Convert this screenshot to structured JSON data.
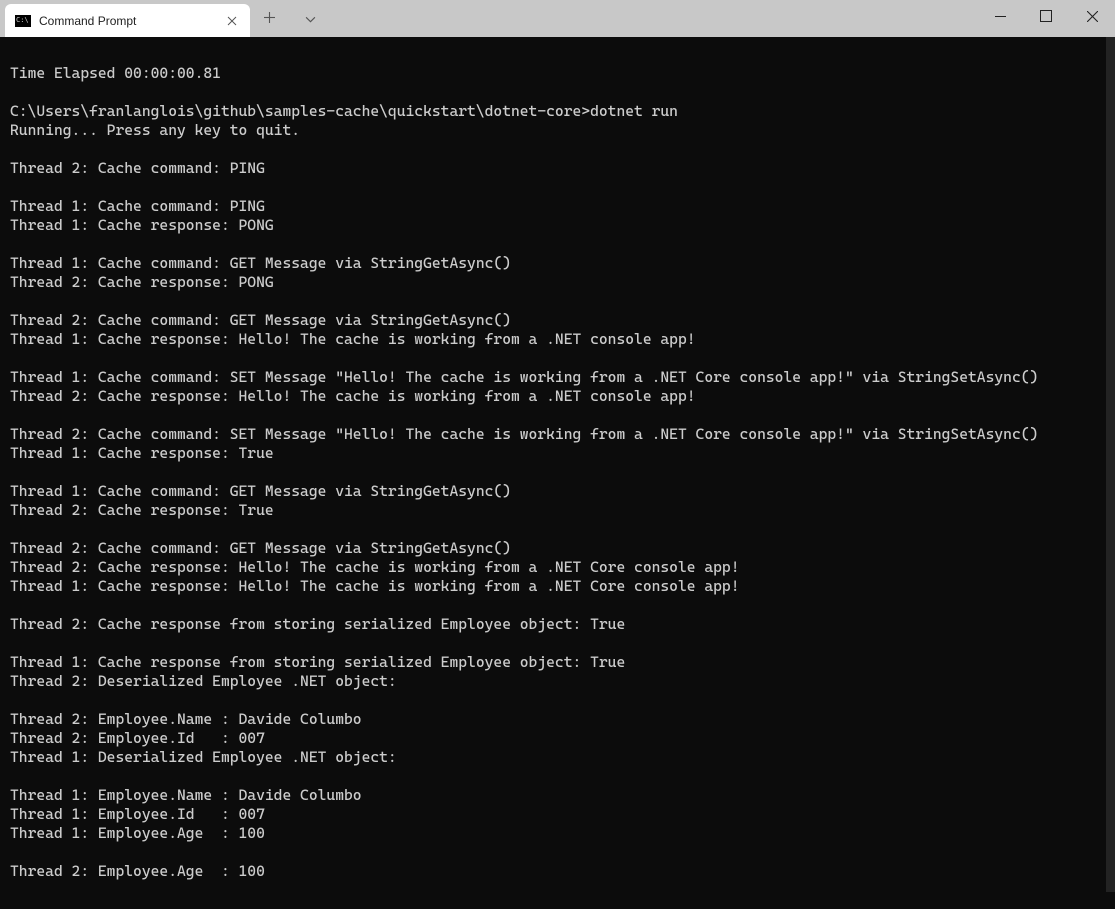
{
  "tab": {
    "title": "Command Prompt"
  },
  "terminal": {
    "lines": [
      "",
      "Time Elapsed 00:00:00.81",
      "",
      "C:\\Users\\franlanglois\\github\\samples-cache\\quickstart\\dotnet-core>dotnet run",
      "Running... Press any key to quit.",
      "",
      "Thread 2: Cache command: PING",
      "",
      "Thread 1: Cache command: PING",
      "Thread 1: Cache response: PONG",
      "",
      "Thread 1: Cache command: GET Message via StringGetAsync()",
      "Thread 2: Cache response: PONG",
      "",
      "Thread 2: Cache command: GET Message via StringGetAsync()",
      "Thread 1: Cache response: Hello! The cache is working from a .NET console app!",
      "",
      "Thread 1: Cache command: SET Message \"Hello! The cache is working from a .NET Core console app!\" via StringSetAsync()",
      "Thread 2: Cache response: Hello! The cache is working from a .NET console app!",
      "",
      "Thread 2: Cache command: SET Message \"Hello! The cache is working from a .NET Core console app!\" via StringSetAsync()",
      "Thread 1: Cache response: True",
      "",
      "Thread 1: Cache command: GET Message via StringGetAsync()",
      "Thread 2: Cache response: True",
      "",
      "Thread 2: Cache command: GET Message via StringGetAsync()",
      "Thread 2: Cache response: Hello! The cache is working from a .NET Core console app!",
      "Thread 1: Cache response: Hello! The cache is working from a .NET Core console app!",
      "",
      "Thread 2: Cache response from storing serialized Employee object: True",
      "",
      "Thread 1: Cache response from storing serialized Employee object: True",
      "Thread 2: Deserialized Employee .NET object:",
      "",
      "Thread 2: Employee.Name : Davide Columbo",
      "Thread 2: Employee.Id   : 007",
      "Thread 1: Deserialized Employee .NET object:",
      "",
      "Thread 1: Employee.Name : Davide Columbo",
      "Thread 1: Employee.Id   : 007",
      "Thread 1: Employee.Age  : 100",
      "",
      "Thread 2: Employee.Age  : 100"
    ]
  }
}
